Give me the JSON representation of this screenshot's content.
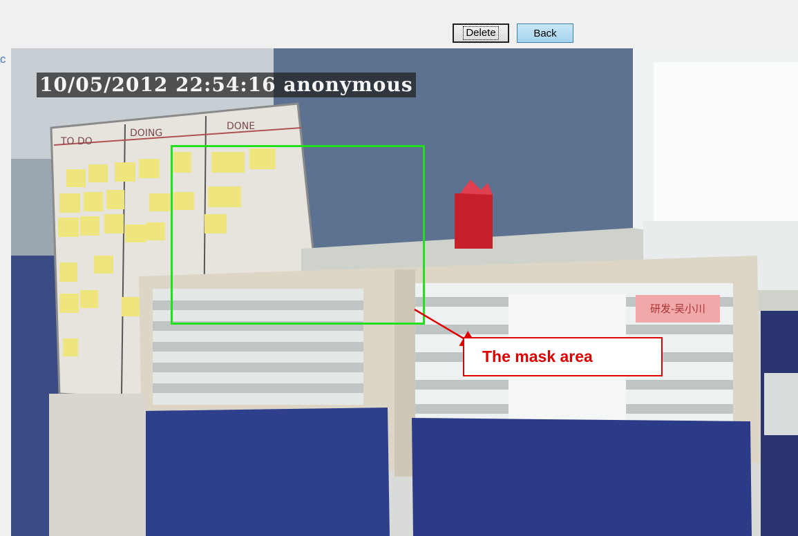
{
  "toolbar": {
    "delete_label": "Delete",
    "back_label": "Back"
  },
  "side_text": "c",
  "video": {
    "timestamp_overlay": "10/05/2012 22:54:16 anonymous",
    "board_headers": [
      "TO DO",
      "DOING",
      "DONE"
    ],
    "desk_sign": "研发-吴小川",
    "mask_color": "#22e01e"
  },
  "annotation": {
    "label": "The mask area",
    "color": "#e00000"
  }
}
